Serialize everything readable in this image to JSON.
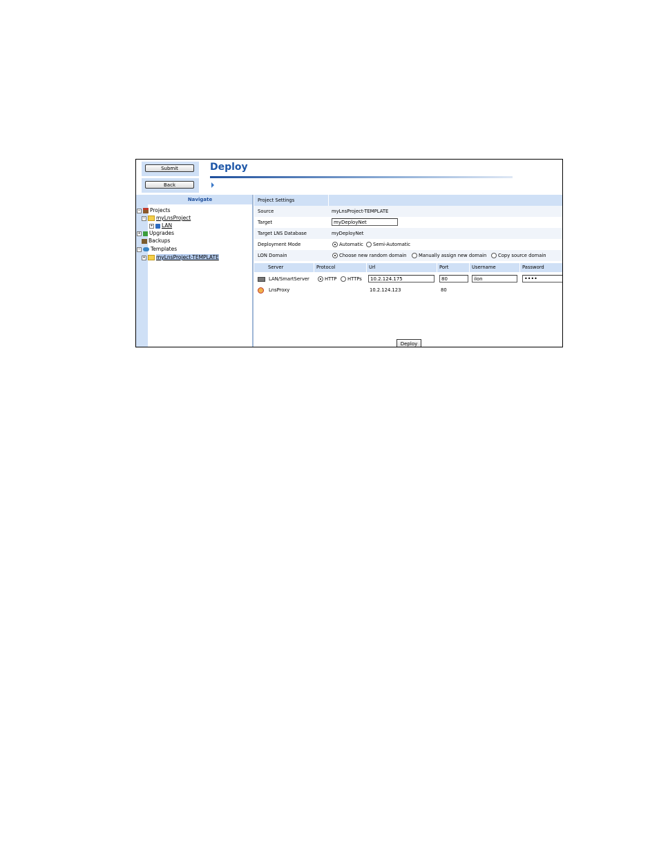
{
  "toolbar": {
    "submit_label": "Submit",
    "back_label": "Back"
  },
  "header": {
    "title": "Deploy"
  },
  "nav": {
    "title": "Navigate",
    "items": [
      {
        "label": "Projects",
        "icon": "house-icon",
        "expander": "−"
      },
      {
        "label": "myLnsProject",
        "icon": "folder-icon",
        "expander": "−"
      },
      {
        "label": "LAN",
        "icon": "network-icon",
        "expander": "+"
      },
      {
        "label": "Upgrades",
        "icon": "upgrades-icon",
        "expander": "+"
      },
      {
        "label": "Backups",
        "icon": "backups-icon",
        "expander": ""
      },
      {
        "label": "Templates",
        "icon": "templates-icon",
        "expander": "−"
      },
      {
        "label": "myLnsProject-TEMPLATE",
        "icon": "folder-icon",
        "expander": "+"
      }
    ]
  },
  "settings": {
    "section_title": "Project Settings",
    "source_label": "Source",
    "source_value": "myLnsProject-TEMPLATE",
    "target_label": "Target",
    "target_value": "myDeployNet",
    "db_label": "Target LNS Database",
    "db_value": "myDeployNet",
    "mode_label": "Deployment Mode",
    "mode_options": [
      "Automatic",
      "Semi-Automatic"
    ],
    "mode_selected": "Automatic",
    "domain_label": "LON Domain",
    "domain_options": [
      "Choose new random domain",
      "Manually assign new domain",
      "Copy source domain"
    ],
    "domain_selected": "Choose new random domain"
  },
  "servers": {
    "columns": [
      "Server",
      "Protocol",
      "Url",
      "Port",
      "Username",
      "Password"
    ],
    "rows": [
      {
        "server": "LAN/SmartServer",
        "icon": "server-icon",
        "protocol_options": [
          "HTTP",
          "HTTPs"
        ],
        "protocol_selected": "HTTP",
        "url": "10.2.124.175",
        "port": "80",
        "username": "ilon",
        "password": "ilon"
      },
      {
        "server": "LnsProxy",
        "icon": "proxy-icon",
        "url": "10.2.124.123",
        "port": "80"
      }
    ]
  },
  "actions": {
    "deploy_label": "Deploy"
  }
}
